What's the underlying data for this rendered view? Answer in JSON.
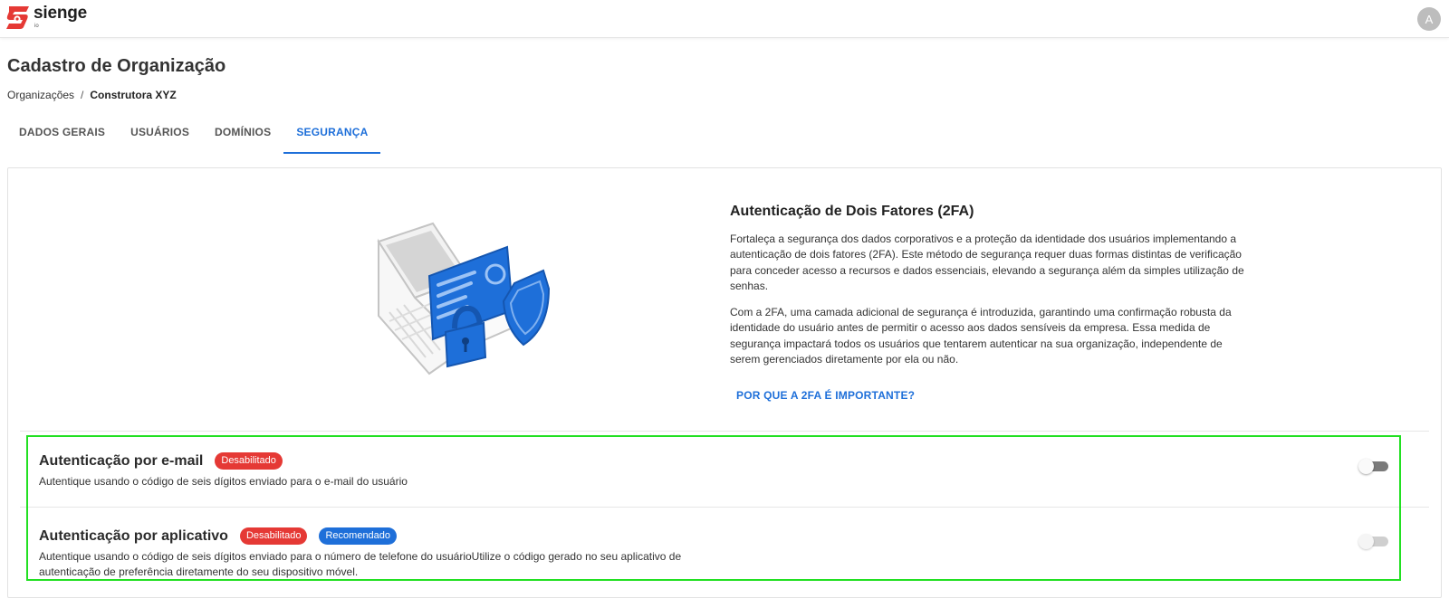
{
  "app": {
    "logo_text": "sienge",
    "logo_sub": "io",
    "avatar_initial": "A"
  },
  "page": {
    "title": "Cadastro de Organização",
    "breadcrumb": {
      "root": "Organizações",
      "separator": "/",
      "current": "Construtora XYZ"
    }
  },
  "tabs": [
    {
      "label": "DADOS GERAIS",
      "active": false
    },
    {
      "label": "USUÁRIOS",
      "active": false
    },
    {
      "label": "DOMÍNIOS",
      "active": false
    },
    {
      "label": "SEGURANÇA",
      "active": true
    }
  ],
  "security": {
    "title": "Autenticação de Dois Fatores (2FA)",
    "paragraph1": "Fortaleça a segurança dos dados corporativos e a proteção da identidade dos usuários implementando a autenticação de dois fatores (2FA). Este método de segurança requer duas formas distintas de verificação para conceder acesso a recursos e dados essenciais, elevando a segurança além da simples utilização de senhas.",
    "paragraph2": "Com a 2FA, uma camada adicional de segurança é introduzida, garantindo uma confirmação robusta da identidade do usuário antes de permitir o acesso aos dados sensíveis da empresa. Essa medida de segurança impactará todos os usuários que tentarem autenticar na sua organização, independente de serem gerenciados diretamente por ela ou não.",
    "link_label": "POR QUE A 2FA É IMPORTANTE?"
  },
  "options": [
    {
      "title": "Autenticação por e-mail",
      "badges": [
        "Desabilitado"
      ],
      "description": "Autentique usando o código de seis dígitos enviado para o e-mail do usuário",
      "toggle_on": false,
      "toggle_disabled": false
    },
    {
      "title": "Autenticação por aplicativo",
      "badges": [
        "Desabilitado",
        "Recomendado"
      ],
      "description": "Autentique usando o código de seis dígitos enviado para o número de telefone do usuárioUtilize o código gerado no seu aplicativo de autenticação de preferência diretamente do seu dispositivo móvel.",
      "toggle_on": false,
      "toggle_disabled": true
    }
  ],
  "colors": {
    "brand_red": "#e53935",
    "accent_blue": "#1e6fd9",
    "highlight_green": "#22e022"
  }
}
